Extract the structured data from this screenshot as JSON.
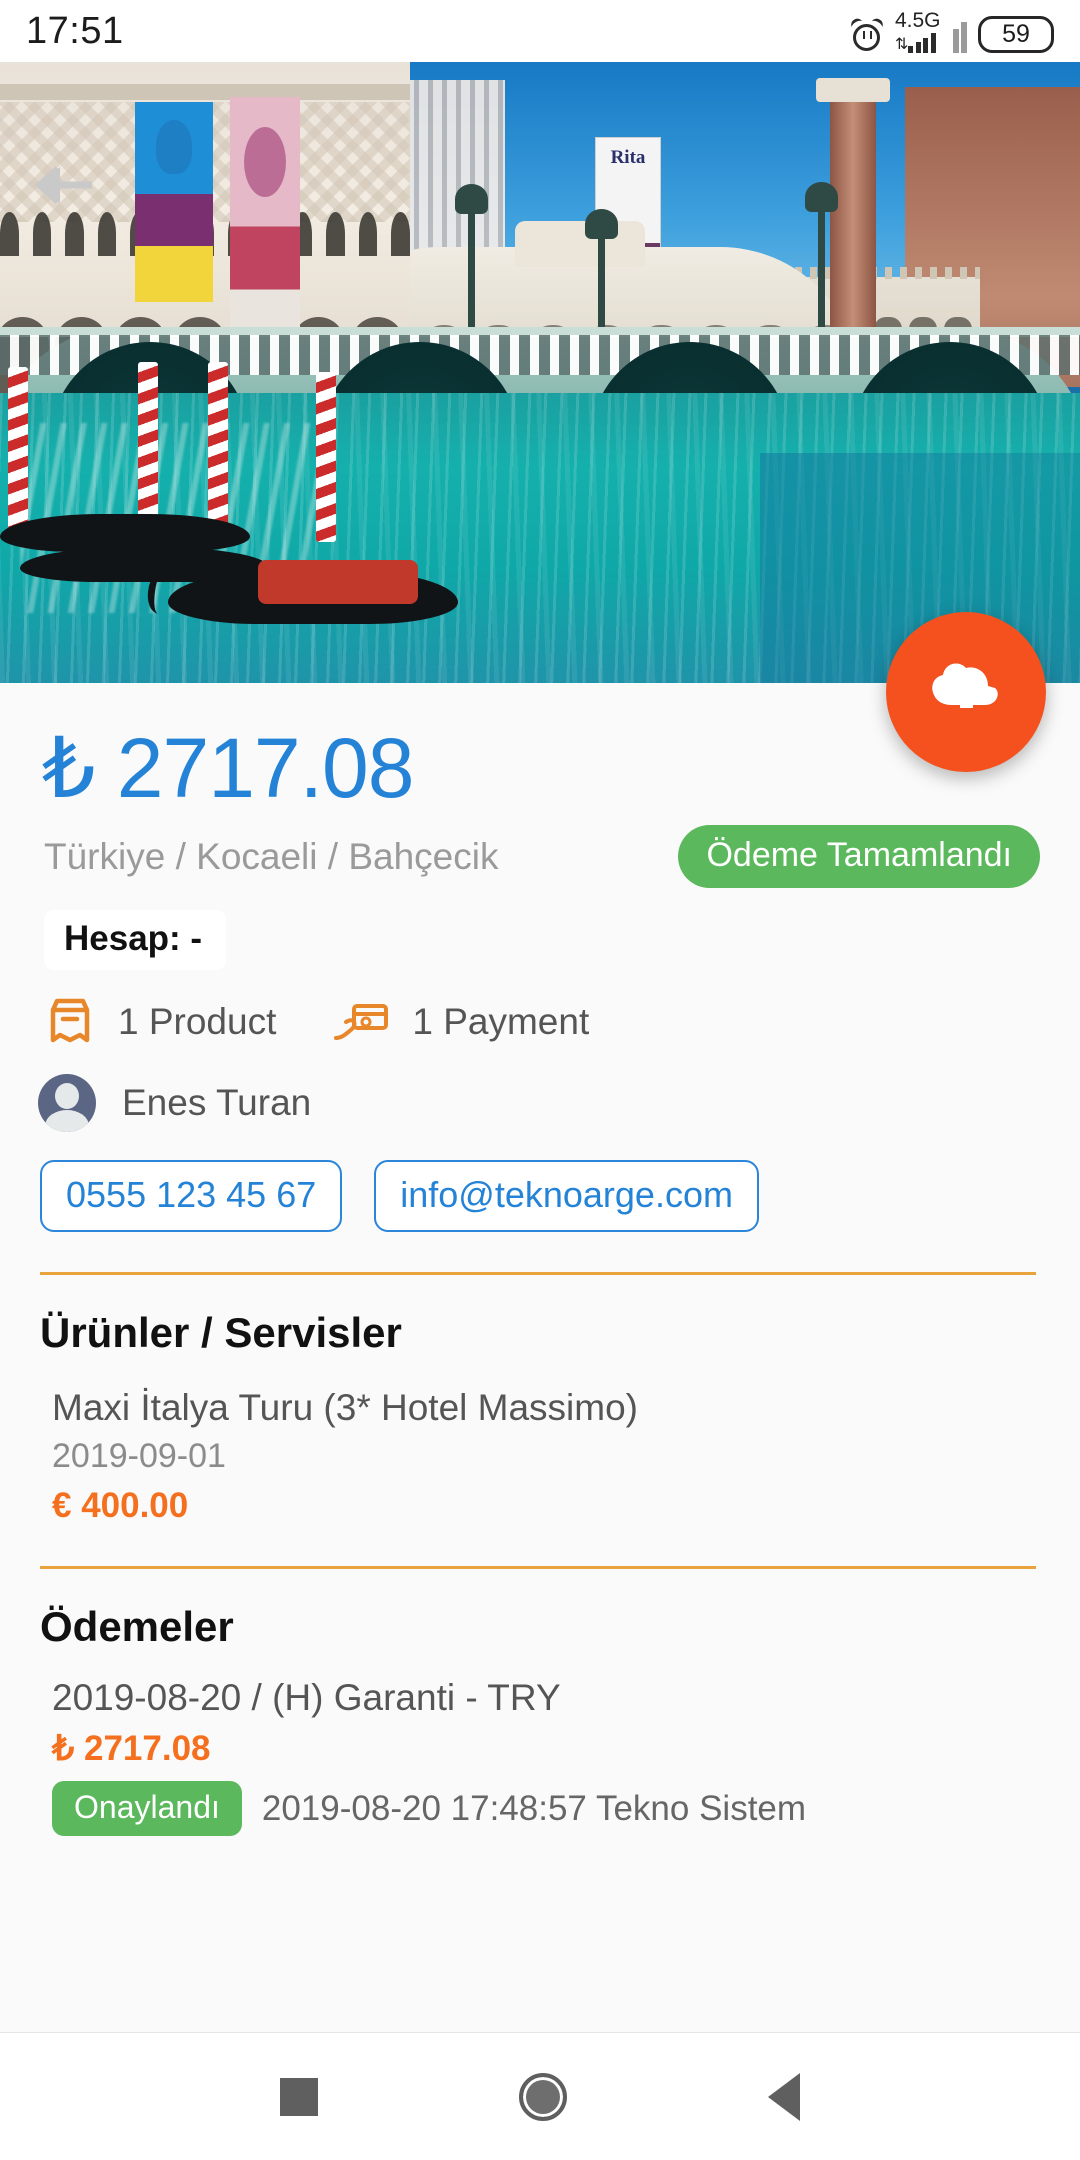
{
  "status_bar": {
    "time": "17:51",
    "alarm_icon": "alarm-icon",
    "network_label": "4.5G",
    "signal_icon": "signal-bars-icon",
    "battery_level": "59"
  },
  "hero": {
    "back_icon": "back-arrow-icon",
    "image_description": "Venetian canal with gondolas and Rialto-style bridge",
    "sign_text": "Rita",
    "fab_icon": "cloud-upload-icon"
  },
  "summary": {
    "currency_symbol": "₺",
    "amount": "2717.08",
    "price_display": "₺ 2717.08",
    "location": "Türkiye / Kocaeli / Bahçecik",
    "status_badge": "Ödeme Tamamlandı",
    "account_label": "Hesap: -",
    "product_icon": "package-icon",
    "product_count": "1 Product",
    "payment_icon": "hand-card-icon",
    "payment_count": "1 Payment",
    "avatar_icon": "avatar-icon",
    "user_name": "Enes Turan",
    "phone": "0555 123 45 67",
    "email": "info@teknoarge.com"
  },
  "products_section": {
    "title": "Ürünler / Servisler",
    "items": [
      {
        "name": "Maxi İtalya Turu (3* Hotel Massimo)",
        "date": "2019-09-01",
        "price": "€ 400.00"
      }
    ]
  },
  "payments_section": {
    "title": "Ödemeler",
    "items": [
      {
        "line": "2019-08-20 / (H) Garanti - TRY",
        "amount": "₺ 2717.08",
        "status": "Onaylandı",
        "meta": "2019-08-20 17:48:57 Tekno Sistem"
      }
    ]
  },
  "nav_bar": {
    "recents_icon": "square-recents-icon",
    "home_icon": "circle-home-icon",
    "back_icon": "triangle-back-icon"
  },
  "colors": {
    "accent_blue": "#2483d6",
    "accent_orange": "#f4701e",
    "fab_orange": "#f4511e",
    "success_green": "#5cb85c",
    "divider_gold": "#e8a33d"
  }
}
